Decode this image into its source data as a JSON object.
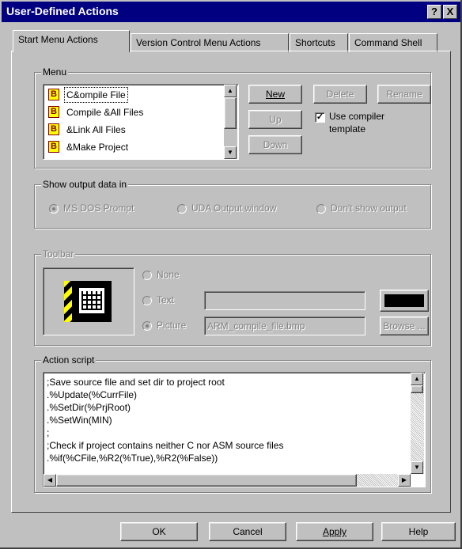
{
  "window": {
    "title": "User-Defined Actions",
    "help_btn": "?",
    "close_btn": "X"
  },
  "tabs": [
    "Start Menu Actions",
    "Version Control Menu Actions",
    "Shortcuts",
    "Command Shell"
  ],
  "menu": {
    "legend": "Menu",
    "items": [
      "C&ompile File",
      "Compile &All Files",
      "&Link All Files",
      "&Make Project"
    ],
    "icon_letter": "B",
    "new_btn": "New",
    "delete_btn": "Delete",
    "rename_btn": "Rename",
    "up_btn": "Up",
    "down_btn": "Down",
    "use_template_line1": "Use compiler",
    "use_template_line2": "template"
  },
  "output": {
    "legend": "Show output data in",
    "opt1": "MS DOS Prompt",
    "opt2": "UDA Output window",
    "opt3": "Don't show output"
  },
  "toolbar": {
    "legend": "Toolbar",
    "none_label": "None",
    "text_label": "Text",
    "picture_label": "Picture",
    "picture_file": "ARM_compile_file.bmp",
    "browse_btn": "Browse ..."
  },
  "script": {
    "legend": "Action script",
    "lines": [
      ";Save source file and set dir to project root",
      ".%Update(%CurrFile)",
      ".%SetDir(%PrjRoot)",
      ".%SetWin(MIN)",
      ";",
      ";Check if project contains neither C nor ASM source files",
      ".%if(%CFile,%R2(%True),%R2(%False))"
    ]
  },
  "buttons": {
    "ok": "OK",
    "cancel": "Cancel",
    "apply": "Apply",
    "help": "Help"
  }
}
